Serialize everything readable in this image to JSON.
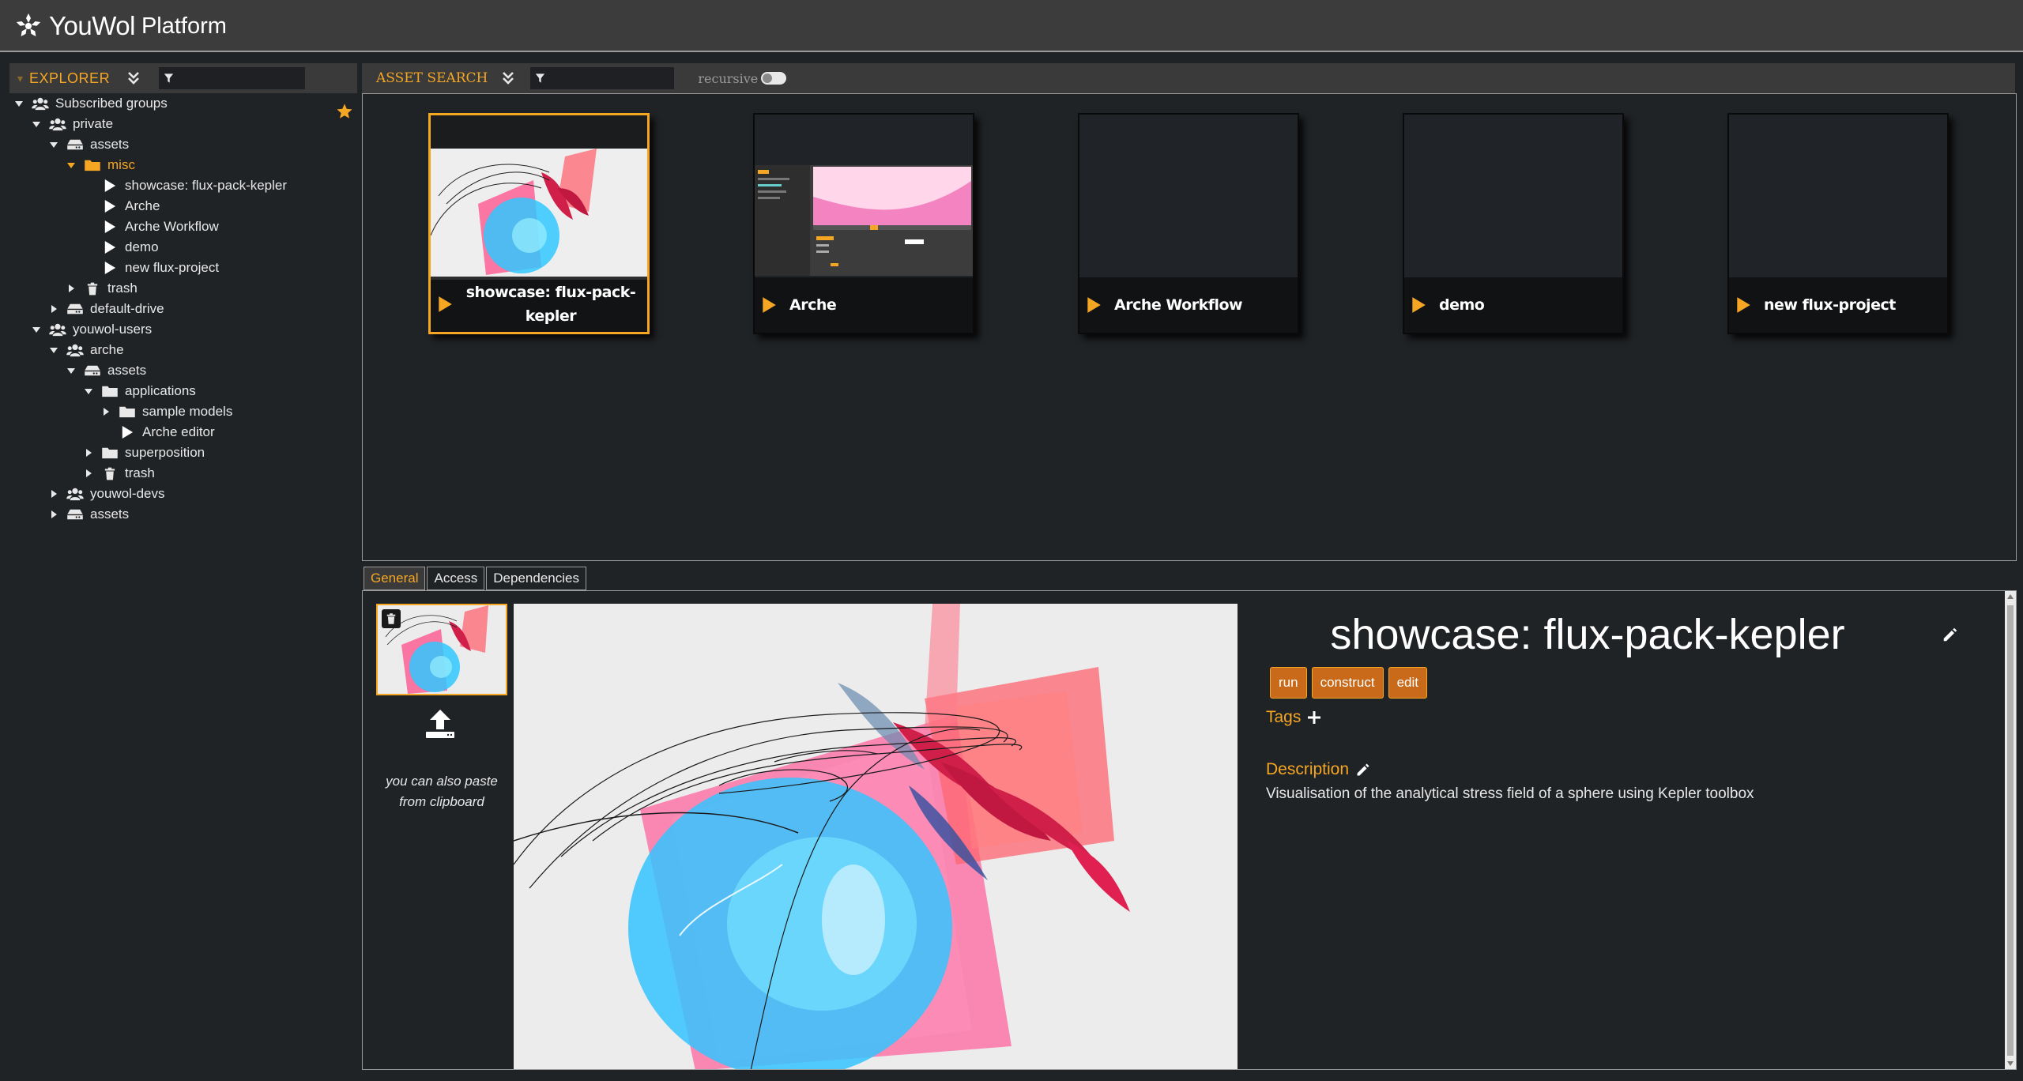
{
  "app": {
    "brand": "YouWol",
    "subtitle": "Platform"
  },
  "explorer": {
    "title": "EXPLORER",
    "filter_value": "",
    "tree": [
      {
        "label": "Subscribed groups",
        "icon": "users-icon",
        "expanded": true
      },
      {
        "label": "private",
        "icon": "users-icon",
        "expanded": true
      },
      {
        "label": "assets",
        "icon": "drive-icon",
        "expanded": true
      },
      {
        "label": "misc",
        "icon": "folder-icon",
        "expanded": true,
        "selected": true
      },
      {
        "label": "showcase: flux-pack-kepler",
        "icon": "play-icon"
      },
      {
        "label": "Arche",
        "icon": "play-icon"
      },
      {
        "label": "Arche Workflow",
        "icon": "play-icon"
      },
      {
        "label": "demo",
        "icon": "play-icon"
      },
      {
        "label": "new flux-project",
        "icon": "play-icon"
      },
      {
        "label": "trash",
        "icon": "trash-icon",
        "expanded": false
      },
      {
        "label": "default-drive",
        "icon": "drive-icon",
        "expanded": false
      },
      {
        "label": "youwol-users",
        "icon": "users-icon",
        "expanded": true
      },
      {
        "label": "arche",
        "icon": "users-icon",
        "expanded": true
      },
      {
        "label": "assets",
        "icon": "drive-icon",
        "expanded": true
      },
      {
        "label": "applications",
        "icon": "folder-icon",
        "expanded": true
      },
      {
        "label": "sample models",
        "icon": "folder-icon",
        "expanded": false
      },
      {
        "label": "Arche editor",
        "icon": "play-icon"
      },
      {
        "label": "superposition",
        "icon": "folder-icon",
        "expanded": false
      },
      {
        "label": "trash",
        "icon": "trash-icon",
        "expanded": false
      },
      {
        "label": "youwol-devs",
        "icon": "users-icon",
        "expanded": false
      },
      {
        "label": "assets",
        "icon": "drive-icon",
        "expanded": false
      }
    ]
  },
  "search": {
    "title": "ASSET SEARCH",
    "filter_value": "",
    "recursive_label": "recursive",
    "recursive": false
  },
  "assets": [
    {
      "name": "showcase: flux-pack-kepler",
      "selected": true
    },
    {
      "name": "Arche"
    },
    {
      "name": "Arche Workflow"
    },
    {
      "name": "demo"
    },
    {
      "name": "new flux-project"
    }
  ],
  "tabs": [
    "General",
    "Access",
    "Dependencies"
  ],
  "active_tab": "General",
  "detail": {
    "paste_hint": "you can also paste from clipboard",
    "title": "showcase: flux-pack-kepler",
    "actions": [
      "run",
      "construct",
      "edit"
    ],
    "tags_label": "Tags",
    "description_label": "Description",
    "description": "Visualisation of the analytical stress field of a sphere using Kepler toolbox"
  },
  "colors": {
    "accent": "#f5a623",
    "button": "#c86a1a",
    "background": "#202326",
    "topbar": "#3c3c3c"
  }
}
